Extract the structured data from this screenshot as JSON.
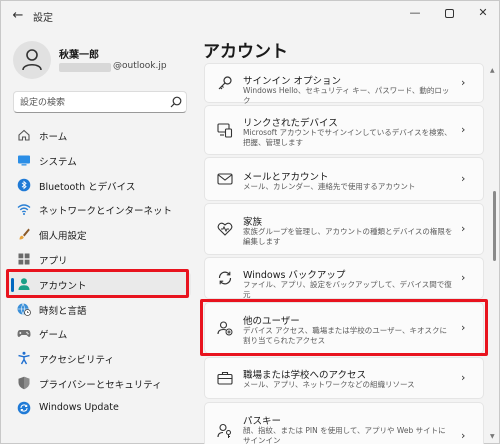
{
  "window": {
    "app_title": "設定",
    "back_glyph": "←",
    "minimize_glyph": "—",
    "close_glyph": "✕"
  },
  "profile": {
    "name": "秋葉一郎",
    "email": "@outlook.jp"
  },
  "search": {
    "placeholder": "設定の検索"
  },
  "nav": {
    "items": [
      {
        "label": "ホーム",
        "icon": "home-icon"
      },
      {
        "label": "システム",
        "icon": "system-icon"
      },
      {
        "label": "Bluetooth とデバイス",
        "icon": "bluetooth-icon"
      },
      {
        "label": "ネットワークとインターネット",
        "icon": "wifi-icon"
      },
      {
        "label": "個人用設定",
        "icon": "brush-icon"
      },
      {
        "label": "アプリ",
        "icon": "apps-icon"
      },
      {
        "label": "アカウント",
        "icon": "account-icon",
        "selected": true
      },
      {
        "label": "時刻と言語",
        "icon": "globe-clock-icon"
      },
      {
        "label": "ゲーム",
        "icon": "gamepad-icon"
      },
      {
        "label": "アクセシビリティ",
        "icon": "accessibility-icon"
      },
      {
        "label": "プライバシーとセキュリティ",
        "icon": "shield-icon"
      },
      {
        "label": "Windows Update",
        "icon": "update-icon"
      }
    ]
  },
  "main": {
    "title": "アカウント",
    "cards": [
      {
        "title": "サインイン オプション",
        "desc": "Windows Hello、セキュリティ キー、パスワード、動的ロック",
        "icon": "key-icon"
      },
      {
        "title": "リンクされたデバイス",
        "desc": "Microsoft アカウントでサインインしているデバイスを検索、把握、管理します",
        "icon": "linked-devices-icon"
      },
      {
        "title": "メールとアカウント",
        "desc": "メール、カレンダー、連絡先で使用するアカウント",
        "icon": "mail-icon"
      },
      {
        "title": "家族",
        "desc": "家族グループを管理し、アカウントの種類とデバイスの権限を編集します",
        "icon": "family-heart-icon"
      },
      {
        "title": "Windows バックアップ",
        "desc": "ファイル、アプリ、設定をバックアップして、デバイス間で復元",
        "icon": "backup-icon"
      },
      {
        "title": "他のユーザー",
        "desc": "デバイス アクセス、職場または学校のユーザー、キオスクに割り当てられたアクセス",
        "icon": "other-users-icon"
      },
      {
        "title": "職場または学校へのアクセス",
        "desc": "メール、アプリ、ネットワークなどの組織リソース",
        "icon": "briefcase-icon"
      },
      {
        "title": "パスキー",
        "desc": "顔、指紋、または PIN を使用して、アプリや Web サイトにサインイン",
        "icon": "passkey-icon"
      }
    ]
  },
  "colors": {
    "accent": "#0067c0",
    "highlight": "#e8131e"
  }
}
